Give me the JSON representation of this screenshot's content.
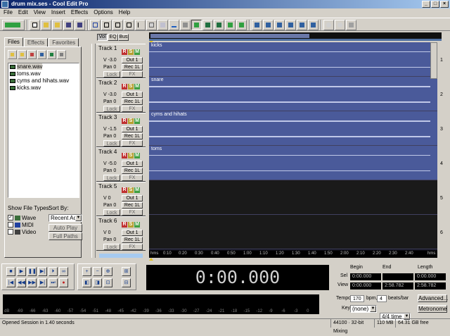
{
  "window": {
    "title": "drum mix.ses - Cool Edit Pro"
  },
  "menu": [
    "File",
    "Edit",
    "View",
    "Insert",
    "Effects",
    "Options",
    "Help"
  ],
  "filepanel": {
    "tabs": [
      "Files",
      "Effects",
      "Favorites"
    ],
    "files": [
      "snare.wav",
      "toms.wav",
      "cyms and hihats.wav",
      "kicks.wav"
    ],
    "show_file_types_label": "Show File Types:",
    "types": [
      {
        "label": "Wave",
        "checked": true
      },
      {
        "label": "MIDI",
        "checked": false
      },
      {
        "label": "Video",
        "checked": false
      }
    ],
    "sort_by_label": "Sort By:",
    "sort_value": "Recent Acc",
    "auto_play": "Auto Play",
    "full_paths": "Full Paths"
  },
  "view_tabs": [
    "Vol",
    "EQ",
    "Bus"
  ],
  "tracks": [
    {
      "name": "Track 1",
      "vol": "V -3.0",
      "pan": "Pan 0",
      "out": "Out 1",
      "rec": "Rec 1L",
      "lock": "Lock",
      "fx": "FX",
      "clip": "kicks",
      "num": "1"
    },
    {
      "name": "Track 2",
      "vol": "V -3.0",
      "pan": "Pan 0",
      "out": "Out 1",
      "rec": "Rec 1L",
      "lock": "Lock",
      "fx": "FX",
      "clip": "snare",
      "num": "2"
    },
    {
      "name": "Track 3",
      "vol": "V -1.5",
      "pan": "Pan 0",
      "out": "Out 1",
      "rec": "Rec 1L",
      "lock": "Lock",
      "fx": "FX",
      "clip": "cyms and hihats",
      "num": "3"
    },
    {
      "name": "Track 4",
      "vol": "V -5.0",
      "pan": "Pan 0",
      "out": "Out 1",
      "rec": "Rec 1L",
      "lock": "Lock",
      "fx": "FX",
      "clip": "toms",
      "num": "4"
    },
    {
      "name": "Track 5",
      "vol": "V 0",
      "pan": "Pan 0",
      "out": "Out 1",
      "rec": "Rec 1L",
      "lock": "Lock",
      "fx": "FX",
      "clip": "",
      "num": "5"
    },
    {
      "name": "Track 6",
      "vol": "V 0",
      "pan": "Pan 0",
      "out": "Out 1",
      "rec": "Rec 1L",
      "lock": "Lock",
      "fx": "FX",
      "clip": "",
      "num": "6"
    }
  ],
  "track_btn_labels": {
    "r": "R",
    "s": "S",
    "m": "M"
  },
  "ruler": [
    "hms",
    "0:10",
    "0:20",
    "0:30",
    "0:40",
    "0:50",
    "1:00",
    "1:10",
    "1:20",
    "1:30",
    "1:40",
    "1:50",
    "2:00",
    "2:10",
    "2:20",
    "2:30",
    "2:40",
    "hms"
  ],
  "time_display": "0:00.000",
  "selview": {
    "headers": [
      "Begin",
      "End",
      "Length"
    ],
    "sel_label": "Sel",
    "view_label": "View",
    "sel": [
      "0:00.000",
      "",
      "0:00.000"
    ],
    "view": [
      "0:00.000",
      "2:58.782",
      "2:58.782"
    ]
  },
  "meter_scale": [
    "dB",
    "-69",
    "-66",
    "-63",
    "-60",
    "-57",
    "-54",
    "-51",
    "-48",
    "-45",
    "-42",
    "-39",
    "-36",
    "-33",
    "-30",
    "-27",
    "-24",
    "-21",
    "-18",
    "-15",
    "-12",
    "-9",
    "-6",
    "-3",
    "0"
  ],
  "tempo": {
    "tempo_label": "Tempo",
    "tempo_value": "170",
    "bpm_label": "bpm,",
    "beats_value": "4",
    "beats_label": "beats/bar",
    "advanced": "Advanced...",
    "key_label": "Key",
    "key_value": "(none)",
    "time_sig": "4/4 time",
    "metronome": "Metronome"
  },
  "status": {
    "message": "Opened Session in 1.40 seconds",
    "format": "44100 · 32-bit Mixing",
    "mem": "110 MB",
    "disk": "64.31 GB free"
  }
}
